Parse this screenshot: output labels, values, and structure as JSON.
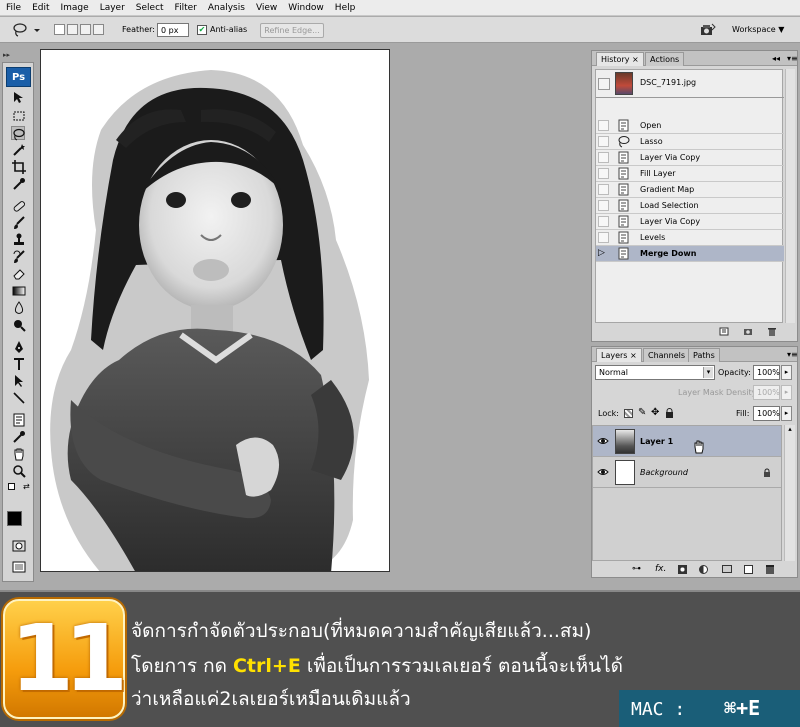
{
  "menu": [
    "File",
    "Edit",
    "Image",
    "Layer",
    "Select",
    "Filter",
    "Analysis",
    "View",
    "Window",
    "Help"
  ],
  "options": {
    "feather_label": "Feather:",
    "feather_value": "0 px",
    "antialias_label": "Anti-alias",
    "antialias_checked": true,
    "refine_edge_label": "Refine Edge...",
    "workspace_label": "Workspace ▼"
  },
  "toolbox": {
    "logo": "Ps",
    "tools": [
      "move-icon",
      "marquee-icon",
      "lasso-icon",
      "magic-wand-icon",
      "crop-icon",
      "eyedropper-icon",
      "healing-icon",
      "brush-icon",
      "clone-stamp-icon",
      "history-brush-icon",
      "eraser-icon",
      "gradient-icon",
      "blur-icon",
      "dodge-icon",
      "pen-icon",
      "type-icon",
      "path-select-icon",
      "line-icon",
      "notes-icon",
      "eyedropper2-icon",
      "hand-icon",
      "zoom-icon"
    ],
    "selected_tool": "lasso-icon",
    "foreground_color": "#000000",
    "background_color": "#ffffff"
  },
  "history": {
    "tabs": [
      "History",
      "Actions"
    ],
    "snapshot_name": "DSC_7191.jpg",
    "steps": [
      "Open",
      "Lasso",
      "Layer Via Copy",
      "Fill Layer",
      "Gradient Map",
      "Load Selection",
      "Layer Via Copy",
      "Levels",
      "Merge Down"
    ],
    "current_step": "Merge Down"
  },
  "layers": {
    "tabs": [
      "Layers",
      "Channels",
      "Paths"
    ],
    "blend_mode": "Normal",
    "opacity_label": "Opacity:",
    "opacity_value": "100%",
    "mask_density_label": "Layer Mask Density",
    "mask_density_value": "100%",
    "lock_label": "Lock:",
    "fill_label": "Fill:",
    "fill_value": "100%",
    "items": [
      {
        "name": "Layer 1",
        "selected": true
      },
      {
        "name": "Background",
        "selected": false,
        "locked": true
      }
    ]
  },
  "banner": {
    "step_number": "11",
    "line1": "จัดการกำจัดตัวประกอบ(ที่หมดความสำคัญเสียแล้ว...สม)",
    "line2_prefix": "โดยการ กด ",
    "line2_shortcut": "Ctrl+E",
    "line2_suffix": " เพื่อเป็นการรวมเลเยอร์ ตอนนี้จะเห็นได้",
    "line3": "ว่าเหลือแค่2เลเยอร์เหมือนเดิมแล้ว",
    "mac_label": "MAC :",
    "mac_shortcut": "⌘+E"
  },
  "colors": {
    "accent_badge": "#f59c0c",
    "highlight_text": "#ffe100",
    "mac_box": "#1a5e78",
    "selected_row": "#aeb6c8"
  }
}
